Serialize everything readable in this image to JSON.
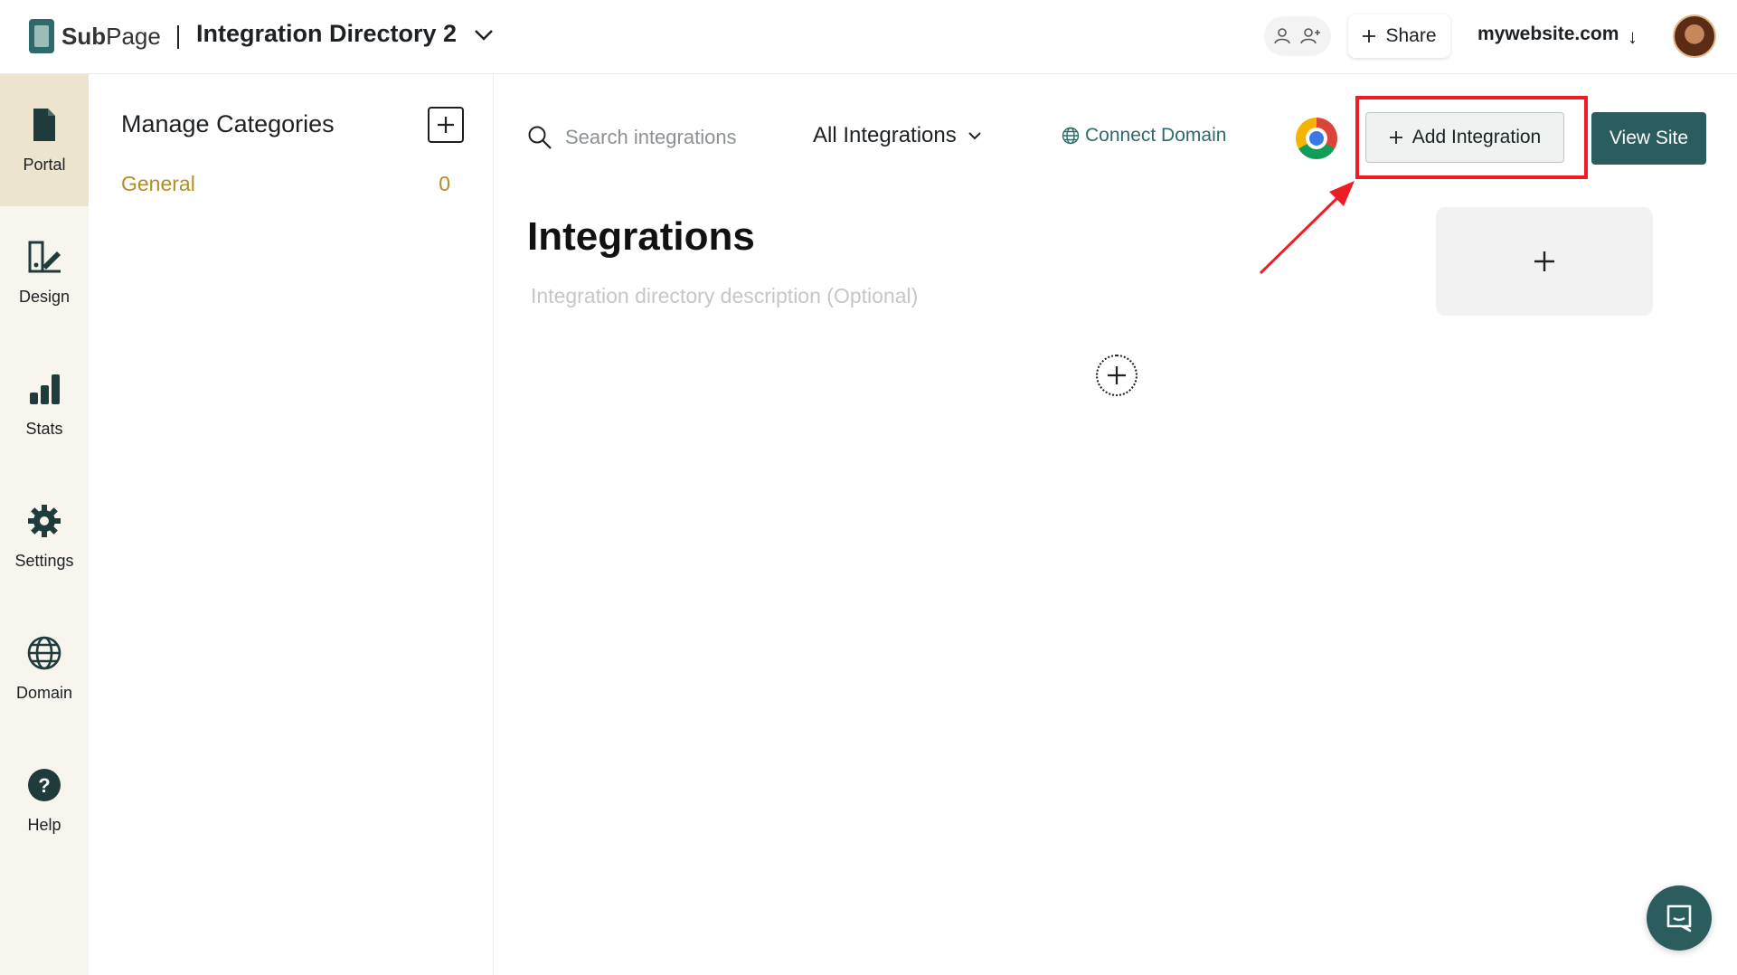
{
  "header": {
    "brand_prefix": "Sub",
    "brand_suffix": "Page",
    "title": "Integration Directory 2",
    "share_label": "Share",
    "site_label": "mywebsite.com",
    "site_arrow": "↓"
  },
  "rail": {
    "items": [
      {
        "label": "Portal",
        "icon": "document-icon",
        "active": true
      },
      {
        "label": "Design",
        "icon": "design-icon"
      },
      {
        "label": "Stats",
        "icon": "bar-chart-icon"
      },
      {
        "label": "Settings",
        "icon": "gear-icon"
      },
      {
        "label": "Domain",
        "icon": "globe-icon"
      },
      {
        "label": "Help",
        "icon": "help-icon"
      }
    ]
  },
  "categories": {
    "title": "Manage Categories",
    "items": [
      {
        "label": "General",
        "count": "0"
      }
    ]
  },
  "toolbar": {
    "search_placeholder": "Search integrations",
    "filter_label": "All Integrations",
    "connect_domain_label": "Connect Domain",
    "add_integration_label": "Add Integration",
    "view_site_label": "View Site"
  },
  "content": {
    "title": "Integrations",
    "description_placeholder": "Integration directory description (Optional)"
  },
  "colors": {
    "accent": "#2b5d5f",
    "category_text": "#b58d24",
    "highlight": "#ee1c24",
    "active_rail": "#ece4cc"
  }
}
